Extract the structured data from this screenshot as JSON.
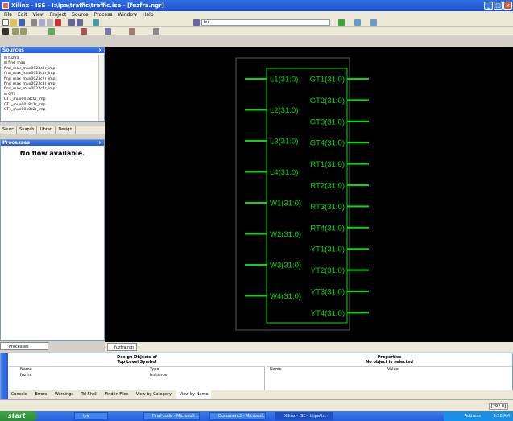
{
  "window": {
    "title": "Xilinx - ISE - I:\\ipa\\traffic\\traffic.ise - [fuzfra.ngr]",
    "min": "_",
    "max": "□",
    "close": "×"
  },
  "menu": [
    "File",
    "Edit",
    "View",
    "Project",
    "Source",
    "Process",
    "Window",
    "Help"
  ],
  "toolbar": {
    "find_value": "hu"
  },
  "sources": {
    "title": "Sources",
    "close": "×",
    "items": [
      "⊟ fuzfra",
      "  ⊞ find_max",
      "    find_max_mux0023c1r_imp",
      "    find_max_mux0023c1r_imp",
      "    find_max_mux0023c2r_imp",
      "    find_max_mux0023c3r_imp",
      "    find_max_mux0023c4r_imp",
      "  ⊞ GT1",
      "    GT1_mux0018c0r_imp",
      "    GT1_mux0018c1r_imp",
      "    GT1_mux0018c2r_imp"
    ],
    "tabs": [
      "Sourc",
      "Snapsh",
      "Librari",
      "Design"
    ]
  },
  "processes": {
    "title": "Processes",
    "close": "×",
    "message": "No flow available.",
    "tab": "Processes"
  },
  "schematic": {
    "inputs": [
      "L1(31:0)",
      "L2(31:0)",
      "L3(31:0)",
      "L4(31:0)",
      "W1(31:0)",
      "W2(31:0)",
      "W3(31:0)",
      "W4(31:0)"
    ],
    "outputs": [
      "GT1(31:0)",
      "GT2(31:0)",
      "GT3(31:0)",
      "GT4(31:0)",
      "RT1(31:0)",
      "RT2(31:0)",
      "RT3(31:0)",
      "RT4(31:0)",
      "YT1(31:0)",
      "YT2(31:0)",
      "YT3(31:0)",
      "YT4(31:0)"
    ],
    "wire_color": "#00e000"
  },
  "doc_tab": "fuzfra.ngr",
  "bottom": {
    "left_title": "Design Objects of",
    "left_title2": "Top Level Symbol",
    "right_title": "Properties",
    "right_title2": "No object is selected",
    "col_name": "Name",
    "col_type": "Type",
    "col_name2": "Name",
    "col_value": "Value",
    "row_name": "fuzfra",
    "row_type": "Instance",
    "side_label": "Transcript"
  },
  "console_tabs": [
    "Console",
    "Errors",
    "Warnings",
    "Tcl Shell",
    "Find in Files",
    "View by Category",
    "View by Name"
  ],
  "status": {
    "coords": "[292,0]"
  },
  "taskbar": {
    "start": "start",
    "items": [
      "ipa",
      "Final code - Microsoft ...",
      "Document3 - Microsof...",
      "Xilinx - ISE - I:\\ipa\\tr..."
    ],
    "address": "Address",
    "time": "9:58 AM"
  }
}
